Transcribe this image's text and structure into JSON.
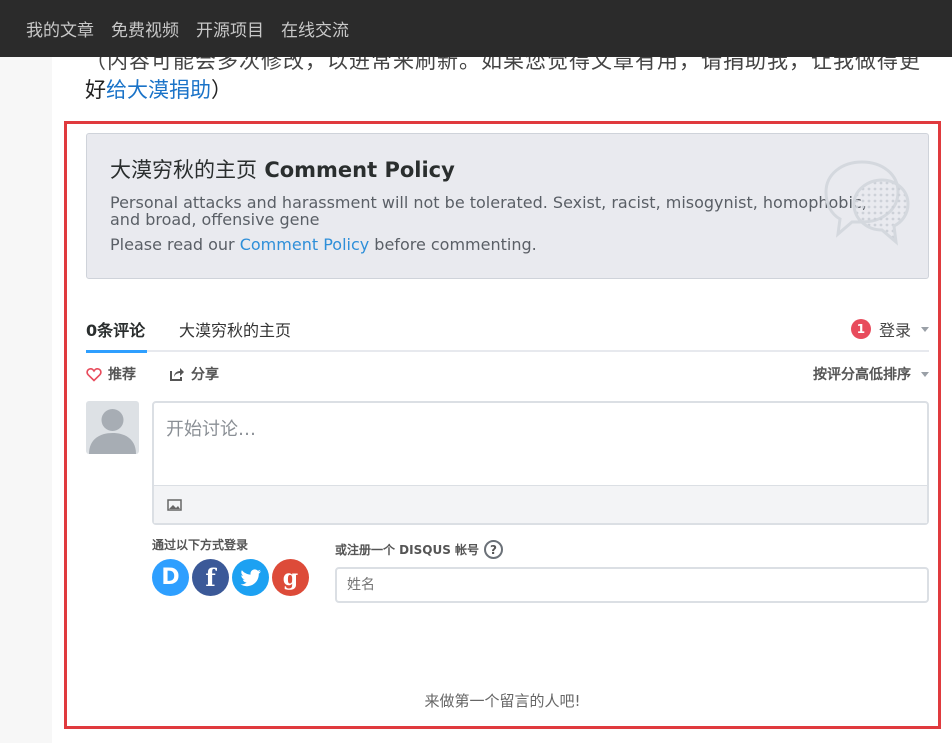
{
  "nav": {
    "items": [
      "我的文章",
      "免费视频",
      "开源项目",
      "在线交流"
    ]
  },
  "intro": {
    "partial_line": "（内容可能会多次修改，以进常来刷新。如果您觉得文章有用，请捐助我，让我做得更",
    "prefix": "好",
    "link": "给大漠捐助",
    "suffix": "）"
  },
  "policy": {
    "site": "大漠穷秋的主页",
    "title": "Comment Policy",
    "text": "Personal attacks and harassment will not be tolerated. Sexist, racist, misogynist, homophobic, and broad, offensive gene",
    "read_prefix": "Please read our ",
    "read_link": "Comment Policy",
    "read_suffix": " before commenting."
  },
  "tabs": {
    "comments": "0条评论",
    "site": "大漠穷秋的主页",
    "badge": "1",
    "login": "登录"
  },
  "actions": {
    "recommend": "推荐",
    "share": "分享",
    "sort": "按评分高低排序"
  },
  "editor": {
    "placeholder": "开始讨论…"
  },
  "auth": {
    "login_with": "通过以下方式登录",
    "register": "或注册一个 DISQUS 帐号",
    "help": "?",
    "name_placeholder": "姓名",
    "socials": {
      "disqus": "D",
      "facebook": "f",
      "google": "g"
    }
  },
  "empty": "来做第一个留言的人吧!",
  "colors": {
    "accent": "#2e9fff",
    "highlight_border": "#e03a3e",
    "badge": "#e84b5c"
  }
}
